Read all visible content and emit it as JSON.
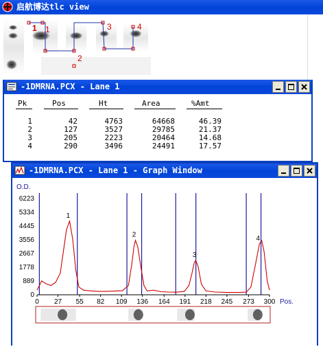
{
  "main_window": {
    "title": "启航博达tlc view"
  },
  "lane_markers": [
    {
      "label": "1",
      "color": "#d00000"
    },
    {
      "label": "1",
      "color": "#d00000"
    },
    {
      "label": "3",
      "color": "#d00000"
    },
    {
      "label": "4",
      "color": "#d00000"
    },
    {
      "label": "2",
      "color": "#d00000"
    }
  ],
  "lane_window": {
    "title": "-1DMRNA.PCX - Lane 1",
    "columns": [
      "Pk",
      "Pos",
      "Ht",
      "Area",
      "%Amt"
    ],
    "rows": [
      [
        "1",
        "42",
        "4763",
        "64668",
        "46.39"
      ],
      [
        "2",
        "127",
        "3527",
        "29785",
        "21.37"
      ],
      [
        "3",
        "205",
        "2223",
        "20464",
        "14.68"
      ],
      [
        "4",
        "290",
        "3496",
        "24491",
        "17.57"
      ]
    ]
  },
  "graph_window": {
    "title": "-1DMRNA.PCX - Lane 1 - Graph Window",
    "y_title": "O.D.",
    "x_title": "Pos.",
    "y_ticks": [
      "6223",
      "5334",
      "4445",
      "3556",
      "2667",
      "1778",
      "889",
      "0"
    ],
    "x_ticks": [
      "0",
      "27",
      "55",
      "82",
      "109",
      "136",
      "164",
      "191",
      "218",
      "245",
      "273",
      "300"
    ]
  },
  "chart_data": {
    "type": "line",
    "title": "",
    "xlabel": "Pos.",
    "ylabel": "O.D.",
    "xlim": [
      0,
      300
    ],
    "ylim": [
      0,
      6223
    ],
    "grid": false,
    "peak_labels": [
      "1",
      "2",
      "3",
      "4"
    ],
    "series": [
      {
        "x": [
          0,
          6,
          12,
          18,
          24,
          30,
          34,
          38,
          42,
          46,
          50,
          54,
          60,
          70,
          80,
          90,
          100,
          110,
          118,
          122,
          125,
          127,
          130,
          134,
          138,
          142,
          150,
          160,
          170,
          180,
          190,
          196,
          200,
          203,
          205,
          208,
          212,
          218,
          230,
          245,
          260,
          270,
          276,
          282,
          287,
          290,
          293,
          297,
          300
        ],
        "y": [
          300,
          900,
          700,
          600,
          800,
          1400,
          2800,
          4200,
          4763,
          3600,
          1600,
          500,
          300,
          250,
          220,
          220,
          240,
          260,
          600,
          1900,
          3100,
          3527,
          3100,
          1800,
          600,
          250,
          300,
          200,
          180,
          170,
          220,
          600,
          1400,
          2100,
          2223,
          1800,
          700,
          250,
          180,
          150,
          150,
          170,
          500,
          2000,
          3300,
          3496,
          2800,
          900,
          300
        ]
      }
    ],
    "band_pairs": [
      [
        3,
        52
      ],
      [
        116,
        135
      ],
      [
        179,
        205
      ],
      [
        270,
        289
      ]
    ],
    "line_color": "#cc0000",
    "band_line_color": "#1a1aa0"
  }
}
